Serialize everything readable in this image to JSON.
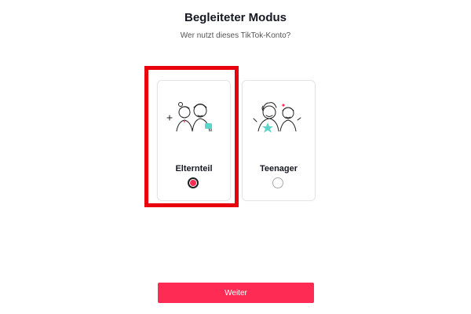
{
  "header": {
    "title": "Begleiteter Modus",
    "subtitle": "Wer nutzt dieses TikTok-Konto?"
  },
  "options": [
    {
      "label": "Elternteil",
      "selected": true,
      "icon": "parent-child-illustration-icon"
    },
    {
      "label": "Teenager",
      "selected": false,
      "icon": "teenagers-illustration-icon"
    }
  ],
  "footer": {
    "next_label": "Weiter"
  },
  "colors": {
    "accent": "#fe2c55",
    "highlight": "#e8000c",
    "teal": "#5ed3c9"
  }
}
